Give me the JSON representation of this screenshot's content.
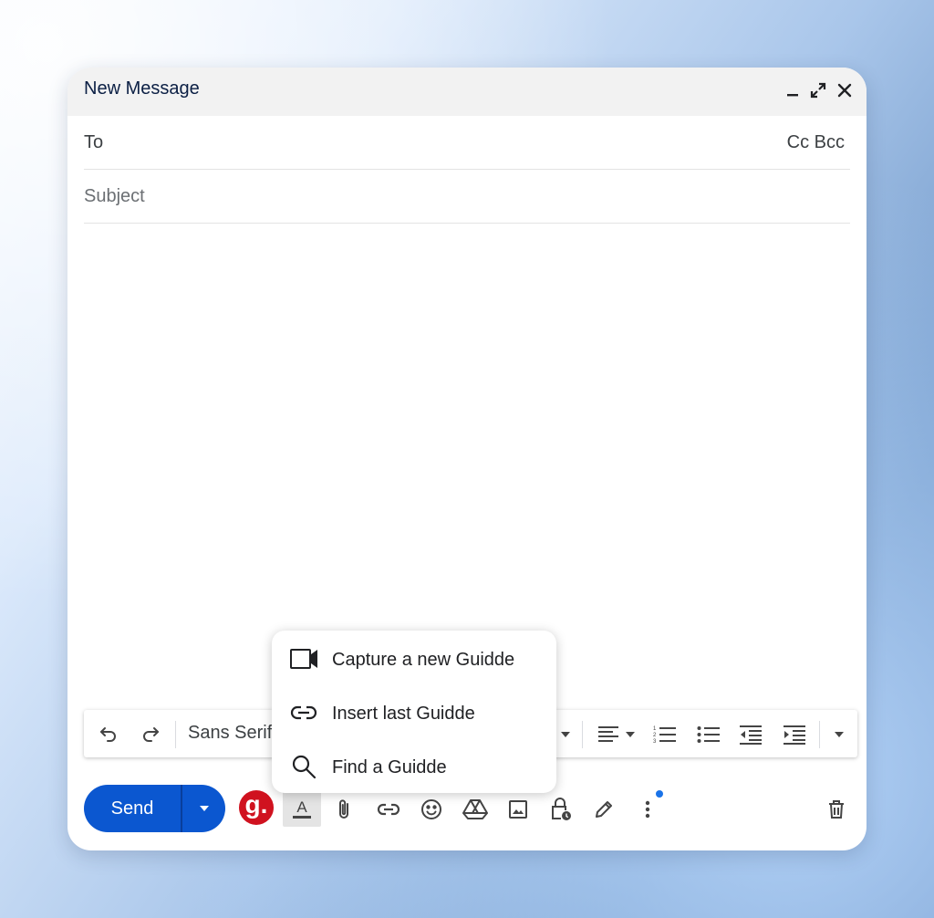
{
  "window": {
    "title": "New Message"
  },
  "recipients": {
    "to_label": "To",
    "cc_label": "Cc",
    "bcc_label": "Bcc"
  },
  "subject": {
    "placeholder": "Subject",
    "value": ""
  },
  "format_bar": {
    "font_name": "Sans Serif",
    "icons": [
      "undo-icon",
      "redo-icon",
      "align-icon",
      "numbered-list-icon",
      "bulleted-list-icon",
      "indent-less-icon",
      "indent-more-icon",
      "more-formatting-icon"
    ]
  },
  "send": {
    "label": "Send"
  },
  "guidde": {
    "logo_text": "g.",
    "brand_color": "#d0121f"
  },
  "guidde_menu": {
    "items": [
      {
        "label": "Capture a new Guidde",
        "icon": "video-camera-icon"
      },
      {
        "label": "Insert last Guidde",
        "icon": "link-icon"
      },
      {
        "label": "Find a Guidde",
        "icon": "search-icon"
      }
    ]
  },
  "bottom_toolbar": {
    "icons": [
      "text-format-icon",
      "attach-icon",
      "link-icon",
      "emoji-icon",
      "drive-icon",
      "photo-icon",
      "confidential-lock-icon",
      "signature-pen-icon",
      "more-options-icon",
      "trash-icon"
    ]
  },
  "colors": {
    "send_blue": "#0b57d0",
    "title_bar": "#f2f2f2",
    "notification_dot": "#1a73e8"
  }
}
